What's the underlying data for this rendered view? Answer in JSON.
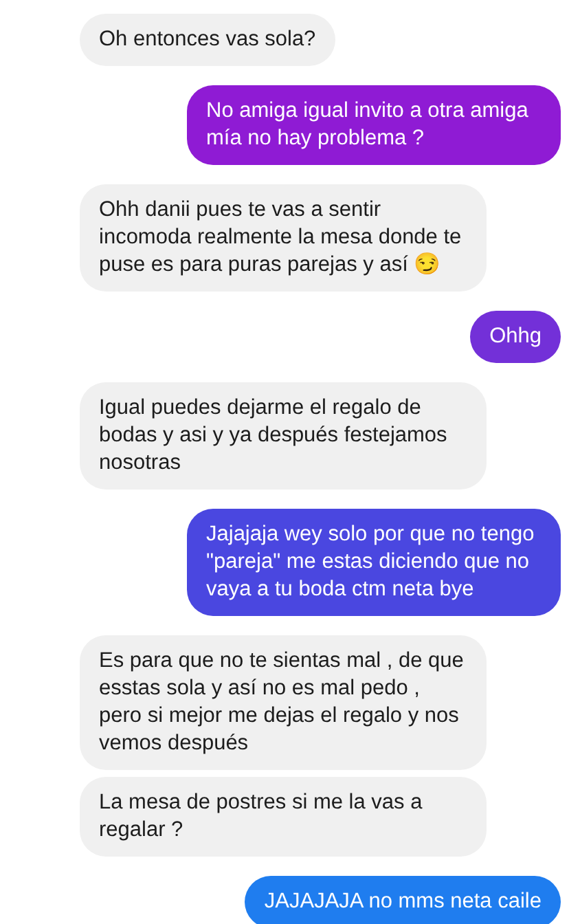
{
  "messages": [
    {
      "kind": "received",
      "text": "Oh entonces vas sola?"
    },
    {
      "kind": "sent",
      "color": "#8f1bd4",
      "text": "No amiga igual invito a otra amiga mía no hay problema ?"
    },
    {
      "kind": "received",
      "text": "Ohh danii pues te vas a sentir incomoda realmente la mesa donde te puse es para puras parejas y así 😏"
    },
    {
      "kind": "sent",
      "color": "#7330d8",
      "text": "Ohhg"
    },
    {
      "kind": "received",
      "text": "Igual puedes dejarme el regalo de bodas y asi y ya después festejamos nosotras"
    },
    {
      "kind": "sent",
      "color": "#4a47e0",
      "text": "Jajajaja wey solo por que no tengo \"pareja\" me estas diciendo que no vaya a tu boda ctm neta bye"
    },
    {
      "kind": "received",
      "text": "Es para que no te sientas mal , de que esstas sola y así no es mal pedo , pero si mejor me dejas el regalo y nos vemos después"
    },
    {
      "kind": "received",
      "text": "La mesa de postres si me la vas a regalar ?"
    },
    {
      "kind": "sent",
      "color": "#1f7def",
      "text": "JAJAJAJA no mms neta caile"
    }
  ]
}
